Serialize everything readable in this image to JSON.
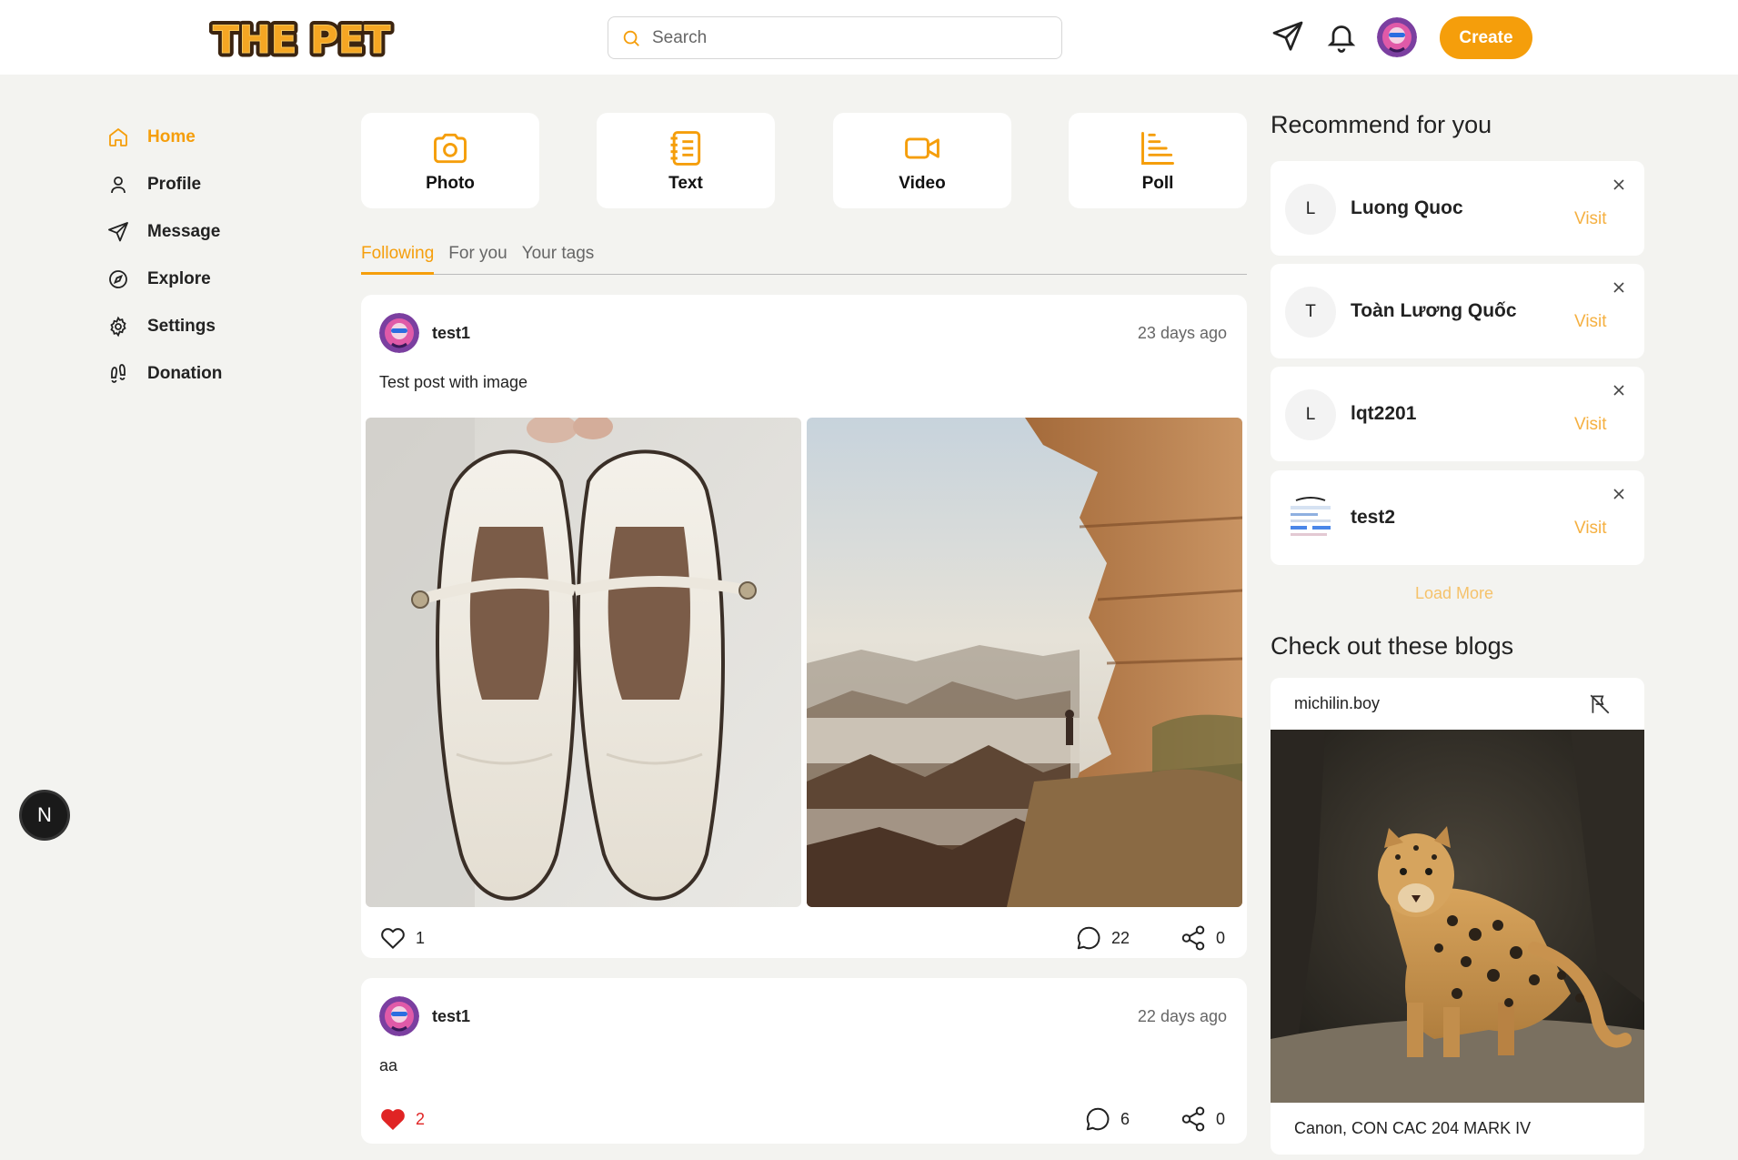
{
  "brand": {
    "logo_text": "THE PET"
  },
  "header": {
    "search_placeholder": "Search",
    "create_label": "Create"
  },
  "sidebar": {
    "items": [
      {
        "label": "Home",
        "icon": "home-icon",
        "active": true
      },
      {
        "label": "Profile",
        "icon": "user-icon"
      },
      {
        "label": "Message",
        "icon": "send-icon"
      },
      {
        "label": "Explore",
        "icon": "compass-icon"
      },
      {
        "label": "Settings",
        "icon": "gear-icon"
      },
      {
        "label": "Donation",
        "icon": "footprints-icon"
      }
    ]
  },
  "nextjs_badge": "N",
  "post_types": [
    {
      "label": "Photo",
      "icon": "camera-icon"
    },
    {
      "label": "Text",
      "icon": "notebook-icon"
    },
    {
      "label": "Video",
      "icon": "video-icon"
    },
    {
      "label": "Poll",
      "icon": "bar-chart-icon"
    }
  ],
  "tabs": [
    {
      "label": "Following",
      "active": true
    },
    {
      "label": "For you"
    },
    {
      "label": "Your tags"
    }
  ],
  "posts": [
    {
      "user": "test1",
      "time": "23 days ago",
      "text": "Test post with image",
      "images": [
        "shoes-photo",
        "canyon-cliff-photo"
      ],
      "likes": "1",
      "liked": false,
      "comments": "22",
      "shares": "0"
    },
    {
      "user": "test1",
      "time": "22 days ago",
      "text": "aa",
      "likes": "2",
      "liked": true,
      "comments": "6",
      "shares": "0"
    }
  ],
  "recommend": {
    "title": "Recommend for you",
    "visit_label": "Visit",
    "users": [
      {
        "initial": "L",
        "name": "Luong Quoc"
      },
      {
        "initial": "T",
        "name": "Toàn Lương Quốc"
      },
      {
        "initial": "L",
        "name": "lqt2201"
      },
      {
        "initial": "",
        "name": "test2"
      }
    ],
    "load_more": "Load More"
  },
  "blogs": {
    "title": "Check out these blogs",
    "user": "michilin.boy",
    "image": "leopard-photo",
    "caption": "Canon, CON CAC 204 MARK IV"
  },
  "colors": {
    "accent": "#f59e0b",
    "like": "#e02424",
    "background": "#f3f3f0"
  }
}
